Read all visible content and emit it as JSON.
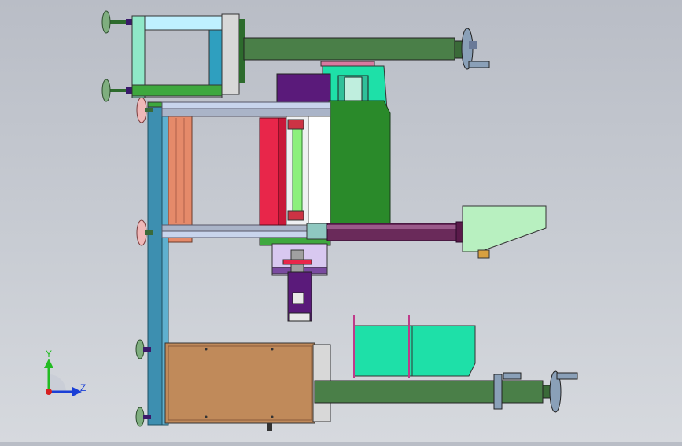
{
  "viewport": {
    "background_top": "#b9bdc6",
    "background_bottom": "#d6d9de"
  },
  "triad": {
    "y_label": "Y",
    "z_label": "Z",
    "y_color": "#22bb22",
    "z_color": "#1a3fd6",
    "x_color": "#d62020"
  },
  "colors": {
    "frame_blue": "#3d8fb0",
    "dark_green": "#3f7a3f",
    "mint": "#9ef0b0",
    "teal": "#1ee0a8",
    "salmon": "#e58a6a",
    "red": "#e8264a",
    "purple": "#5a1a7a",
    "pipe_purple": "#6a2a5a",
    "wood": "#c08a5a",
    "grey_rail": "#aab4c8",
    "green_panel": "#2a8a2a"
  }
}
